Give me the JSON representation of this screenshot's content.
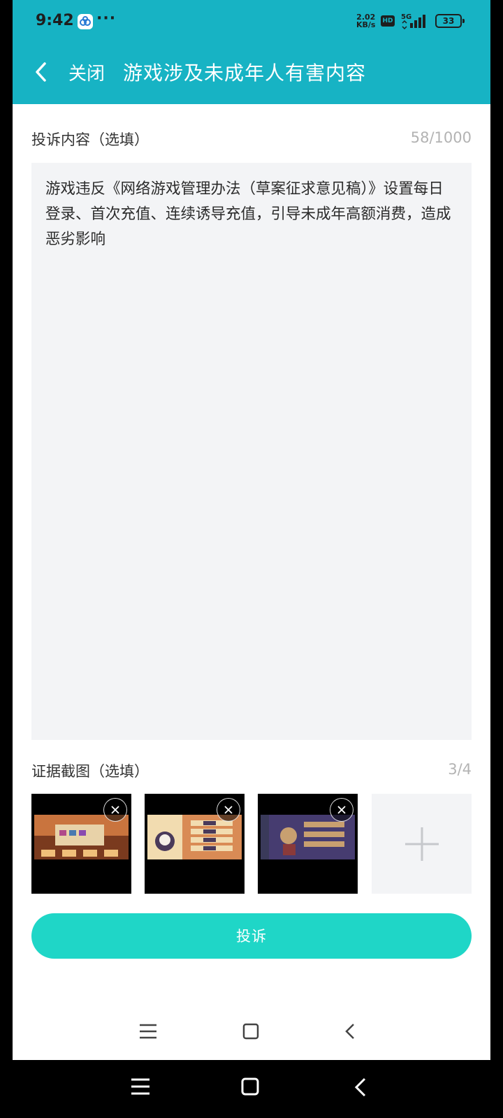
{
  "status_bar": {
    "time": "9:42",
    "dots": "···",
    "net_speed_value": "2.02",
    "net_speed_unit": "KB/s",
    "hd": "HD",
    "network": "5G",
    "battery": "33"
  },
  "header": {
    "back_icon": "chevron-left-icon",
    "close_label": "关闭",
    "title": "游戏涉及未成年人有害内容"
  },
  "complaint": {
    "label": "投诉内容（选填）",
    "counter": "58/1000",
    "text": "游戏违反《网络游戏管理办法（草案征求意见稿）》设置每日登录、首次充值、连续诱导充值，引导未成年高额消费，造成恶劣影响"
  },
  "evidence": {
    "label": "证据截图（选填）",
    "counter": "3/4",
    "thumbnails": [
      {
        "name": "screenshot-1",
        "palette": [
          "#c9743e",
          "#7a3a1e",
          "#f0c07a"
        ]
      },
      {
        "name": "screenshot-2",
        "palette": [
          "#d98b55",
          "#4a3a5a",
          "#f2dcb0"
        ]
      },
      {
        "name": "screenshot-3",
        "palette": [
          "#5a4a8a",
          "#2a2a4a",
          "#c8a070"
        ]
      }
    ],
    "add_icon": "plus-icon"
  },
  "submit_label": "投诉",
  "nav": {
    "menu_icon": "menu-icon",
    "home_icon": "home-icon",
    "back_icon": "back-icon"
  },
  "colors": {
    "header_bg": "#17b3c4",
    "button_bg": "#1fd6c7",
    "field_bg": "#f3f4f6"
  }
}
